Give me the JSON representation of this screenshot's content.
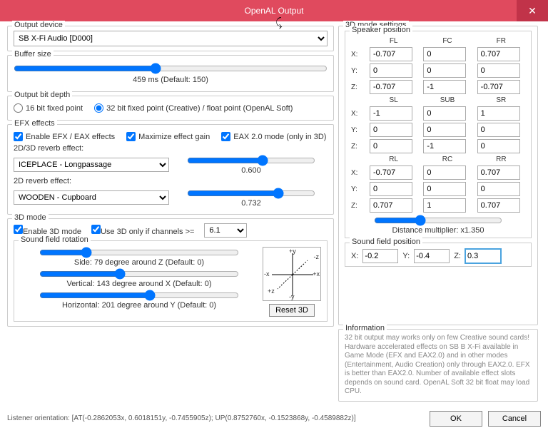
{
  "window": {
    "title": "OpenAL Output",
    "close": "✕"
  },
  "output_device": {
    "label": "Output device",
    "value": "SB X-Fi Audio [D000]"
  },
  "buffer": {
    "label": "Buffer size",
    "text": "459 ms (Default: 150)"
  },
  "bitdepth": {
    "label": "Output bit depth",
    "opt16": "16 bit fixed point",
    "opt32": "32 bit fixed point (Creative) / float point (OpenAL Soft)"
  },
  "efx": {
    "label": "EFX effects",
    "enable": "Enable EFX / EAX effects",
    "maximize": "Maximize effect gain",
    "eax2": "EAX 2.0 mode (only in 3D)",
    "reverb2d3d_label": "2D/3D reverb effect:",
    "reverb2d3d_value": "ICEPLACE - Longpassage",
    "reverb2d3d_slider": "0.600",
    "reverb2d_label": "2D reverb effect:",
    "reverb2d_value": "WOODEN - Cupboard",
    "reverb2d_slider": "0.732"
  },
  "mode3d": {
    "label": "3D mode",
    "enable": "Enable 3D mode",
    "only_if": "Use 3D only if channels >=",
    "channels": "6.1",
    "rotation_label": "Sound field rotation",
    "side": "Side: 79 degree around Z (Default: 0)",
    "vertical": "Vertical: 143 degree around X (Default: 0)",
    "horizontal": "Horizontal: 201 degree around Y (Default: 0)",
    "reset": "Reset 3D"
  },
  "settings3d": {
    "label": "3D mode settings",
    "speaker_label": "Speaker position",
    "cols1": [
      "FL",
      "FC",
      "FR"
    ],
    "cols2": [
      "SL",
      "SUB",
      "SR"
    ],
    "cols3": [
      "RL",
      "RC",
      "RR"
    ],
    "rows1": {
      "x": [
        "-0.707",
        "0",
        "0.707"
      ],
      "y": [
        "0",
        "0",
        "0"
      ],
      "z": [
        "-0.707",
        "-1",
        "-0.707"
      ]
    },
    "rows2": {
      "x": [
        "-1",
        "0",
        "1"
      ],
      "y": [
        "0",
        "0",
        "0"
      ],
      "z": [
        "0",
        "-1",
        "0"
      ]
    },
    "rows3": {
      "x": [
        "-0.707",
        "0",
        "0.707"
      ],
      "y": [
        "0",
        "0",
        "0"
      ],
      "z": [
        "0.707",
        "1",
        "0.707"
      ]
    },
    "dist_label": "Distance multiplier: x1.350",
    "sfp_label": "Sound field position",
    "sfp": {
      "x": "-0.2",
      "y": "-0.4",
      "z": "0.3"
    }
  },
  "info": {
    "label": "Information",
    "text": "32 bit output may works only on few Creative sound cards! Hardware accelerated effects on SB B X-Fi available in Game Mode (EFX and EAX2.0) and in other modes (Entertainment, Audio Creation) only through EAX2.0. EFX is better than EAX2.0. Number of available effect slots depends on sound card. OpenAL Soft 32 bit float may load CPU."
  },
  "footer": {
    "listener": "Listener orientation: [AT(-0.2862053x, 0.6018151y, -0.7455905z); UP(0.8752760x, -0.1523868y, -0.4589882z)]",
    "ok": "OK",
    "cancel": "Cancel"
  },
  "axes": {
    "py": "+y",
    "nz": "-z",
    "nx": "-x",
    "px": "+x",
    "pz": "+z",
    "ny": "-y"
  }
}
